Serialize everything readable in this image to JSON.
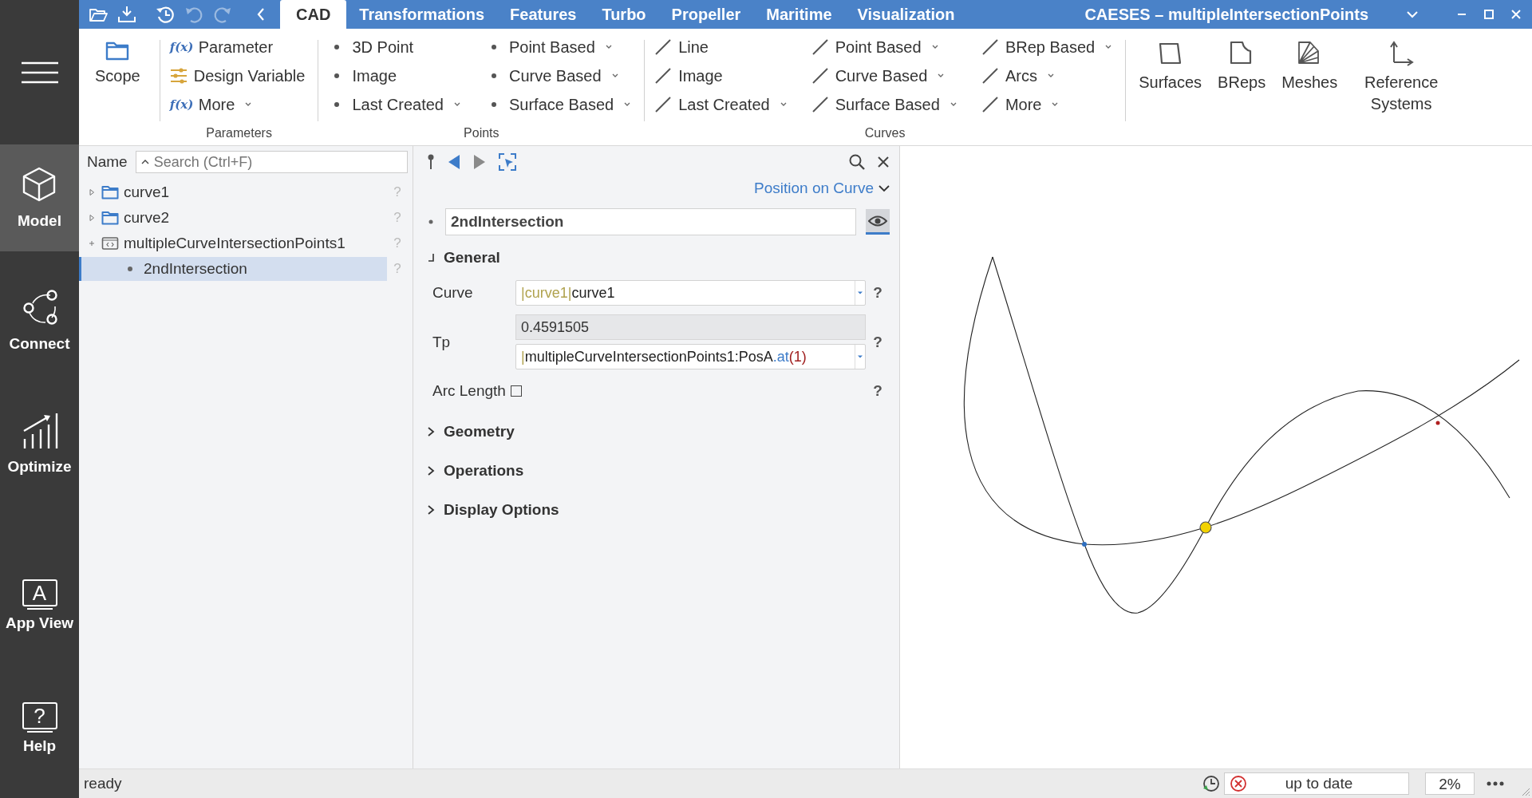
{
  "sidebar": {
    "items": [
      {
        "label": "Model",
        "kind": "cube",
        "selected": true
      },
      {
        "label": "Connect",
        "kind": "connect",
        "selected": false
      },
      {
        "label": "Optimize",
        "kind": "chart",
        "selected": false
      },
      {
        "label": "App View",
        "kind": "screen",
        "glyph": "A",
        "selected": false
      },
      {
        "label": "Help",
        "kind": "screen",
        "glyph": "?",
        "selected": false
      }
    ]
  },
  "quick_access": [
    {
      "kind": "open",
      "disabled": false
    },
    {
      "kind": "save",
      "disabled": false
    },
    {
      "kind": "history",
      "disabled": false
    },
    {
      "kind": "undo",
      "disabled": true
    },
    {
      "kind": "redo",
      "disabled": true
    },
    {
      "kind": "back",
      "disabled": false
    }
  ],
  "tabs": [
    {
      "label": "CAD",
      "selected": true
    },
    {
      "label": "Transformations",
      "selected": false
    },
    {
      "label": "Features",
      "selected": false
    },
    {
      "label": "Turbo",
      "selected": false
    },
    {
      "label": "Propeller",
      "selected": false
    },
    {
      "label": "Maritime",
      "selected": false
    },
    {
      "label": "Visualization",
      "selected": false
    }
  ],
  "window": {
    "title": "CAESES – multipleIntersectionPoints"
  },
  "ribbon": {
    "scope": {
      "label": "Scope"
    },
    "groups": [
      {
        "label": "Parameters",
        "columns": [
          [
            {
              "label": "Parameter",
              "icon_text": "f(x)",
              "dropdown": false
            },
            {
              "label": "Design Variable",
              "kind": "sliders",
              "dropdown": false
            },
            {
              "label": "More",
              "icon_text": "f(x)",
              "dropdown": true
            }
          ]
        ]
      },
      {
        "label": "Points",
        "columns": [
          [
            {
              "label": "3D Point",
              "kind": "dot",
              "dropdown": false
            },
            {
              "label": "Image",
              "kind": "dot",
              "dropdown": false
            },
            {
              "label": "Last Created",
              "kind": "dot",
              "dropdown": true
            }
          ],
          [
            {
              "label": "Point Based",
              "kind": "dot",
              "dropdown": true
            },
            {
              "label": "Curve Based",
              "kind": "dot",
              "dropdown": true
            },
            {
              "label": "Surface Based",
              "kind": "dot",
              "dropdown": true
            }
          ]
        ]
      },
      {
        "label": "Curves",
        "columns": [
          [
            {
              "label": "Line",
              "kind": "line",
              "dropdown": false
            },
            {
              "label": "Image",
              "kind": "line",
              "dropdown": false
            },
            {
              "label": "Last Created",
              "kind": "line",
              "dropdown": true
            }
          ],
          [
            {
              "label": "Point Based",
              "kind": "line",
              "dropdown": true
            },
            {
              "label": "Curve Based",
              "kind": "line",
              "dropdown": true
            },
            {
              "label": "Surface Based",
              "kind": "line",
              "dropdown": true
            }
          ],
          [
            {
              "label": "BRep Based",
              "kind": "line",
              "dropdown": true
            },
            {
              "label": "Arcs",
              "kind": "line",
              "dropdown": true
            },
            {
              "label": "More",
              "kind": "line",
              "dropdown": true
            }
          ]
        ]
      }
    ],
    "big_buttons": [
      {
        "label": "Surfaces",
        "kind": "surface"
      },
      {
        "label": "BReps",
        "kind": "brep"
      },
      {
        "label": "Meshes",
        "kind": "mesh"
      },
      {
        "label": "Reference Systems",
        "kind": "axes"
      }
    ]
  },
  "tree": {
    "header": "Name",
    "search": {
      "placeholder": "Search (Ctrl+F)"
    },
    "rows": [
      {
        "label": "curve1",
        "kind": "folder",
        "expanded": false,
        "selected": false,
        "help": "?"
      },
      {
        "label": "curve2",
        "kind": "folder",
        "expanded": false,
        "selected": false,
        "help": "?"
      },
      {
        "label": "multipleCurveIntersectionPoints1",
        "kind": "script",
        "expanded": true,
        "selected": false,
        "help": "?",
        "children": [
          {
            "label": "2ndIntersection",
            "kind": "dot",
            "selected": true,
            "help": "?"
          }
        ]
      }
    ]
  },
  "properties": {
    "type_selector": "Position on Curve",
    "name": "2ndIntersection",
    "visible": true,
    "sections": [
      {
        "title": "General",
        "expanded": true,
        "fields": [
          {
            "kind": "expression",
            "label": "Curve",
            "parts": [
              {
                "text": "|curve1|",
                "kind": "ref"
              },
              {
                "text": "curve1",
                "kind": "plain"
              }
            ],
            "help": "?"
          },
          {
            "kind": "computed",
            "label": "Tp",
            "result": "0.4591505",
            "parts": [
              {
                "text": "|",
                "kind": "ref"
              },
              {
                "text": "multipleCurveIntersectionPoints1:PosA",
                "kind": "plain"
              },
              {
                "text": ".at",
                "kind": "method"
              },
              {
                "text": "(1)",
                "kind": "paren"
              }
            ],
            "help": "?"
          },
          {
            "kind": "checkbox",
            "label": "Arc Length",
            "checked": false,
            "help": "?"
          }
        ]
      },
      {
        "title": "Geometry",
        "expanded": false
      },
      {
        "title": "Operations",
        "expanded": false
      },
      {
        "title": "Display Options",
        "expanded": false
      }
    ]
  },
  "status_bar": {
    "message": "ready",
    "state": "up to date",
    "progress": "2%"
  }
}
